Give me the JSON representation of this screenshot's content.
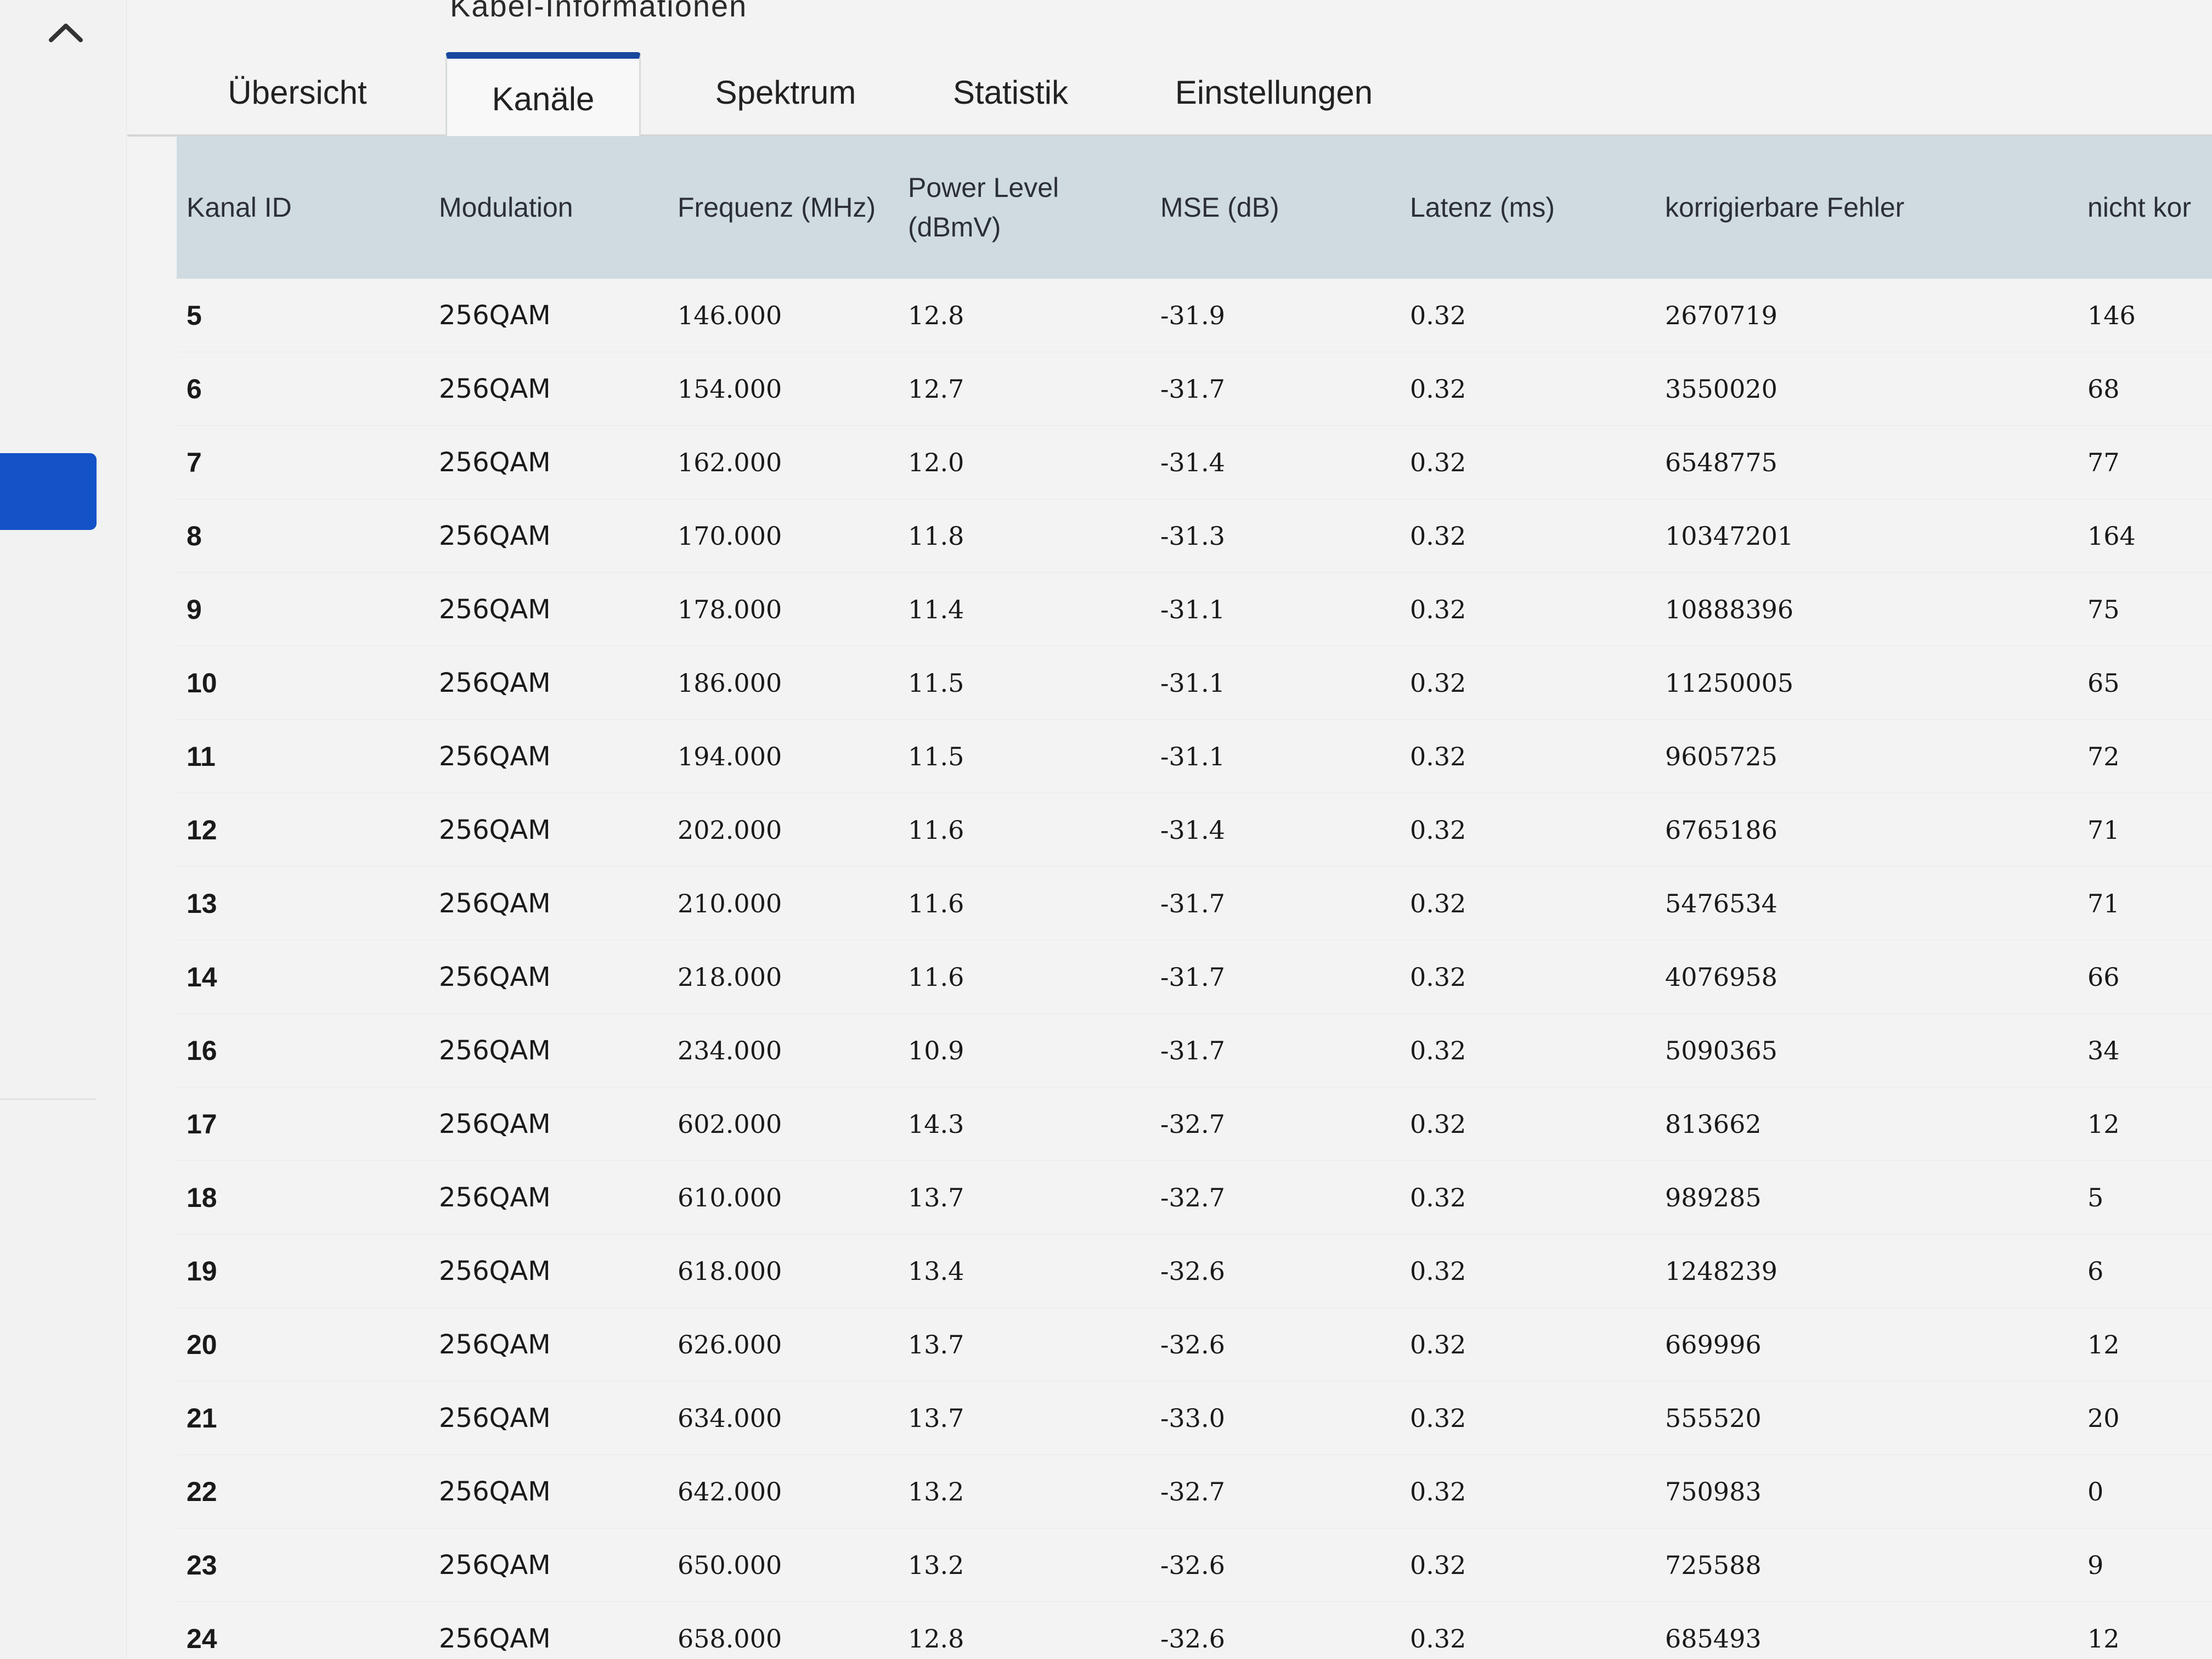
{
  "section_title": "Kabel-Informationen",
  "sidebar": {
    "collapse_icon": "chevron-up-icon",
    "accent_color": "#1452c8"
  },
  "tabs": [
    {
      "label": "Übersicht",
      "active": false
    },
    {
      "label": "Kanäle",
      "active": true
    },
    {
      "label": "Spektrum",
      "active": false
    },
    {
      "label": "Statistik",
      "active": false
    },
    {
      "label": "Einstellungen",
      "active": false
    }
  ],
  "table": {
    "headers": {
      "kanal_id": "Kanal ID",
      "modulation": "Modulation",
      "frequenz": "Frequenz (MHz)",
      "power_level_line1": "Power Level",
      "power_level_line2": "(dBmV)",
      "mse": "MSE (dB)",
      "latenz": "Latenz (ms)",
      "korrigierbar": "korrigierbare Fehler",
      "nicht_korrigierbar": "nicht kor"
    },
    "rows": [
      [
        "5",
        "256QAM",
        "146.000",
        "12.8",
        "-31.9",
        "0.32",
        "2670719",
        "146"
      ],
      [
        "6",
        "256QAM",
        "154.000",
        "12.7",
        "-31.7",
        "0.32",
        "3550020",
        "68"
      ],
      [
        "7",
        "256QAM",
        "162.000",
        "12.0",
        "-31.4",
        "0.32",
        "6548775",
        "77"
      ],
      [
        "8",
        "256QAM",
        "170.000",
        "11.8",
        "-31.3",
        "0.32",
        "10347201",
        "164"
      ],
      [
        "9",
        "256QAM",
        "178.000",
        "11.4",
        "-31.1",
        "0.32",
        "10888396",
        "75"
      ],
      [
        "10",
        "256QAM",
        "186.000",
        "11.5",
        "-31.1",
        "0.32",
        "11250005",
        "65"
      ],
      [
        "11",
        "256QAM",
        "194.000",
        "11.5",
        "-31.1",
        "0.32",
        "9605725",
        "72"
      ],
      [
        "12",
        "256QAM",
        "202.000",
        "11.6",
        "-31.4",
        "0.32",
        "6765186",
        "71"
      ],
      [
        "13",
        "256QAM",
        "210.000",
        "11.6",
        "-31.7",
        "0.32",
        "5476534",
        "71"
      ],
      [
        "14",
        "256QAM",
        "218.000",
        "11.6",
        "-31.7",
        "0.32",
        "4076958",
        "66"
      ],
      [
        "16",
        "256QAM",
        "234.000",
        "10.9",
        "-31.7",
        "0.32",
        "5090365",
        "34"
      ],
      [
        "17",
        "256QAM",
        "602.000",
        "14.3",
        "-32.7",
        "0.32",
        "813662",
        "12"
      ],
      [
        "18",
        "256QAM",
        "610.000",
        "13.7",
        "-32.7",
        "0.32",
        "989285",
        "5"
      ],
      [
        "19",
        "256QAM",
        "618.000",
        "13.4",
        "-32.6",
        "0.32",
        "1248239",
        "6"
      ],
      [
        "20",
        "256QAM",
        "626.000",
        "13.7",
        "-32.6",
        "0.32",
        "669996",
        "12"
      ],
      [
        "21",
        "256QAM",
        "634.000",
        "13.7",
        "-33.0",
        "0.32",
        "555520",
        "20"
      ],
      [
        "22",
        "256QAM",
        "642.000",
        "13.2",
        "-32.7",
        "0.32",
        "750983",
        "0"
      ],
      [
        "23",
        "256QAM",
        "650.000",
        "13.2",
        "-32.6",
        "0.32",
        "725588",
        "9"
      ],
      [
        "24",
        "256QAM",
        "658.000",
        "12.8",
        "-32.6",
        "0.32",
        "685493",
        "12"
      ]
    ]
  }
}
